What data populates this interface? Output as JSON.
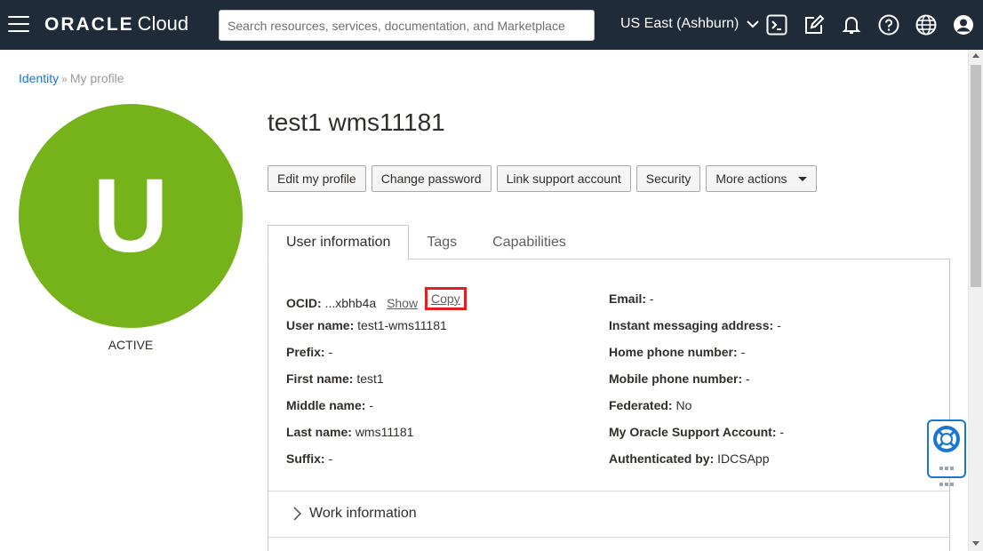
{
  "header": {
    "brand_oracle": "ORACLE",
    "brand_cloud": "Cloud",
    "search_placeholder": "Search resources, services, documentation, and Marketplace",
    "region": "US East (Ashburn)",
    "icons": [
      "menu-icon",
      "cloud-shell-icon",
      "edit-icon",
      "bell-icon",
      "help-icon",
      "globe-icon",
      "user-icon"
    ]
  },
  "breadcrumb": {
    "root": "Identity",
    "separator": "»",
    "current": "My profile"
  },
  "profile": {
    "avatar_letter": "U",
    "avatar_color": "#76b31b",
    "status": "ACTIVE",
    "title": "test1 wms11181"
  },
  "actions": {
    "edit_profile": "Edit my profile",
    "change_password": "Change password",
    "link_support": "Link support account",
    "security": "Security",
    "more_actions": "More actions"
  },
  "tabs": [
    {
      "label": "User information",
      "active": true
    },
    {
      "label": "Tags",
      "active": false
    },
    {
      "label": "Capabilities",
      "active": false
    }
  ],
  "user_info": {
    "left": [
      {
        "label": "OCID:",
        "value": "...xbhb4a"
      },
      {
        "label": "User name:",
        "value": "test1-wms11181"
      },
      {
        "label": "Prefix:",
        "value": "-"
      },
      {
        "label": "First name:",
        "value": "test1"
      },
      {
        "label": "Middle name:",
        "value": "-"
      },
      {
        "label": "Last name:",
        "value": "wms11181"
      },
      {
        "label": "Suffix:",
        "value": "-"
      }
    ],
    "right": [
      {
        "label": "Email:",
        "value": "-"
      },
      {
        "label": "Instant messaging address:",
        "value": "-"
      },
      {
        "label": "Home phone number:",
        "value": "-"
      },
      {
        "label": "Mobile phone number:",
        "value": "-"
      },
      {
        "label": "Federated:",
        "value": "No"
      },
      {
        "label": "My Oracle Support Account:",
        "value": "-"
      },
      {
        "label": "Authenticated by:",
        "value": "IDCSApp"
      }
    ],
    "show_link": "Show",
    "copy_link": "Copy",
    "highlight_color": "#e02020"
  },
  "sections": {
    "work_information": "Work information"
  },
  "colors": {
    "header_bg": "#1f2b38",
    "link": "#1b76d2"
  }
}
